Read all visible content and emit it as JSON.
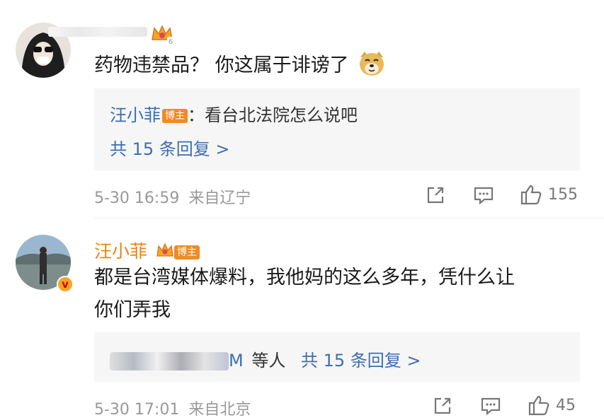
{
  "comments": [
    {
      "crown_level": "6",
      "text": "药物违禁品？ 你这属于诽谤了",
      "emoji": "doge-emoji",
      "reply": {
        "name": "汪小菲",
        "owner_tag": "博主",
        "text": "：看台北法院怎么说吧",
        "count_text": "共 15 条回复 >"
      },
      "time": "5-30 16:59",
      "location": "来自辽宁",
      "likes": "155"
    },
    {
      "name": "汪小菲",
      "owner_tag": "博主",
      "text_line1": "都是台湾媒体爆料，我他妈的这么多年，凭什么让",
      "text_line2": "你们弄我",
      "reply_summary": {
        "visible_suffix": "M",
        "others_text": "等人",
        "count_text": "共 15 条回复 >"
      },
      "time": "5-30 17:01",
      "location": "来自北京",
      "likes": "45"
    }
  ],
  "icons": [
    "share-icon",
    "comment-icon",
    "like-icon",
    "crown-icon",
    "verified-badge-icon"
  ]
}
